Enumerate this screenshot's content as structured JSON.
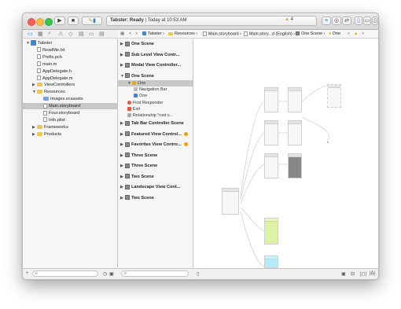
{
  "window": {
    "scheme": "Tabster",
    "status_app": "Tabster:",
    "status_state": "Ready",
    "status_time": "Today at 10:53 AM",
    "warning_count": "4"
  },
  "jumpbar": {
    "crumbs": [
      "Tabster",
      "Resources",
      "Main.storyboard",
      "Main.story...d (English)",
      "One Scene",
      "One"
    ]
  },
  "navigator": {
    "items": [
      {
        "label": "Tabster",
        "kind": "project",
        "indent": 0,
        "disclosure": "▼"
      },
      {
        "label": "ReadMe.txt",
        "kind": "file",
        "indent": 1
      },
      {
        "label": "Prefix.pch",
        "kind": "file",
        "indent": 1
      },
      {
        "label": "main.m",
        "kind": "file",
        "indent": 1
      },
      {
        "label": "AppDelegate.h",
        "kind": "file",
        "indent": 1
      },
      {
        "label": "AppDelegate.m",
        "kind": "file",
        "indent": 1
      },
      {
        "label": "ViewControllers",
        "kind": "folder",
        "indent": 1,
        "disclosure": "▶"
      },
      {
        "label": "Resources",
        "kind": "folder",
        "indent": 1,
        "disclosure": "▼"
      },
      {
        "label": "Images.xcassets",
        "kind": "folder-blue",
        "indent": 2
      },
      {
        "label": "Main.storyboard",
        "kind": "file",
        "indent": 2,
        "selected": true
      },
      {
        "label": "Four.storyboard",
        "kind": "file",
        "indent": 2
      },
      {
        "label": "Info.plist",
        "kind": "file",
        "indent": 2
      },
      {
        "label": "Frameworks",
        "kind": "folder",
        "indent": 1,
        "disclosure": "▶"
      },
      {
        "label": "Products",
        "kind": "folder",
        "indent": 1,
        "disclosure": "▶"
      }
    ]
  },
  "outline": {
    "scenes_top": [
      {
        "label": "One Scene",
        "disclosure": "▶"
      },
      {
        "label": "Sub Level View Contr...",
        "disclosure": "▶"
      },
      {
        "label": "Modal View Controller...",
        "disclosure": "▶"
      },
      {
        "label": "One Scene",
        "disclosure": "▼"
      }
    ],
    "one_children": [
      {
        "label": "One",
        "indent": 1,
        "disclosure": "▼",
        "selected": true
      },
      {
        "label": "Navigation Bar",
        "indent": 2
      },
      {
        "label": "One",
        "indent": 2
      },
      {
        "label": "First Responder",
        "indent": 1
      },
      {
        "label": "Exit",
        "indent": 1
      },
      {
        "label": "Relationship \"root v...",
        "indent": 1
      }
    ],
    "scenes_bottom": [
      {
        "label": "Tab Bar Controller Scene",
        "disclosure": "▶",
        "warning": false
      },
      {
        "label": "Featured View Control...",
        "disclosure": "▶",
        "warning": true
      },
      {
        "label": "Favorites View Contro...",
        "disclosure": "▶",
        "warning": true
      },
      {
        "label": "Three Scene",
        "disclosure": "▶",
        "warning": false
      },
      {
        "label": "Three Scene",
        "disclosure": "▶",
        "warning": false
      },
      {
        "label": "Two Scene",
        "disclosure": "▶",
        "warning": false
      },
      {
        "label": "Landscape View Cont...",
        "disclosure": "▶",
        "warning": false
      },
      {
        "label": "Two Scene",
        "disclosure": "▶",
        "warning": false
      }
    ]
  },
  "colors": {
    "close": "#fc605c",
    "minimize": "#fdbc40",
    "zoom": "#34c84a",
    "green_scene": "#dcf3a5",
    "cyan_scene": "#b5ecf8",
    "gray_scene": "#888888"
  },
  "icons": {
    "run": "play-icon",
    "stop": "stop-icon",
    "warning": "warning-icon",
    "filter": "filter-icon"
  }
}
